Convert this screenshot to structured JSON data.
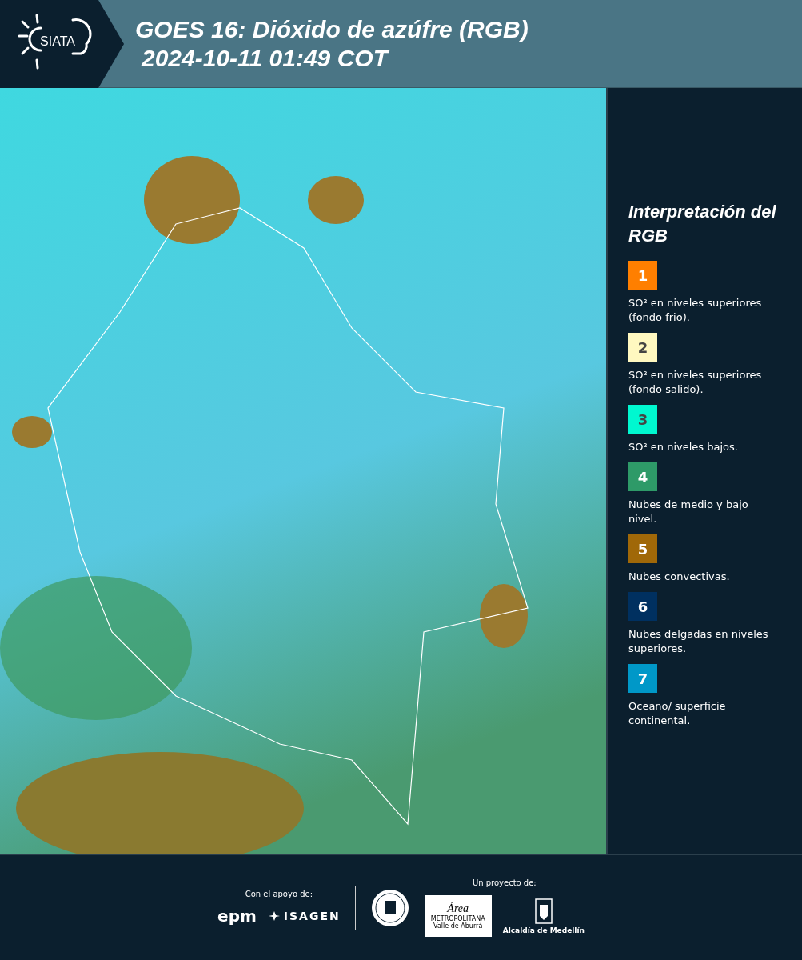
{
  "header": {
    "logo_text": "SIATA",
    "title": "GOES 16: Dióxido de azúfre (RGB)",
    "subtitle": "2024-10-11 01:49 COT"
  },
  "legend": {
    "title": "Interpretación del RGB",
    "items": [
      {
        "number": "1",
        "color": "#ff7f00",
        "text": "SO² en niveles superiores (fondo frio)."
      },
      {
        "number": "2",
        "color": "#fff8c0",
        "text": "SO² en niveles superiores (fondo salido)."
      },
      {
        "number": "3",
        "color": "#00f8d0",
        "text": "SO² en niveles bajos."
      },
      {
        "number": "4",
        "color": "#2e9a68",
        "text": "Nubes de medio y bajo nivel."
      },
      {
        "number": "5",
        "color": "#a06808",
        "text": "Nubes convectivas."
      },
      {
        "number": "6",
        "color": "#003060",
        "text": "Nubes delgadas en niveles superiores."
      },
      {
        "number": "7",
        "color": "#0098c8",
        "text": "Oceano/ superficie continental."
      }
    ]
  },
  "footer": {
    "support_label": "Con el apoyo de:",
    "support_logos": [
      "epm",
      "ISAGEN"
    ],
    "project_label": "Un proyecto de:",
    "area_logo": {
      "name": "Área",
      "line1": "METROPOLITANA",
      "line2": "Valle de Aburrá"
    },
    "alcaldia": "Alcaldía de Medellín"
  }
}
